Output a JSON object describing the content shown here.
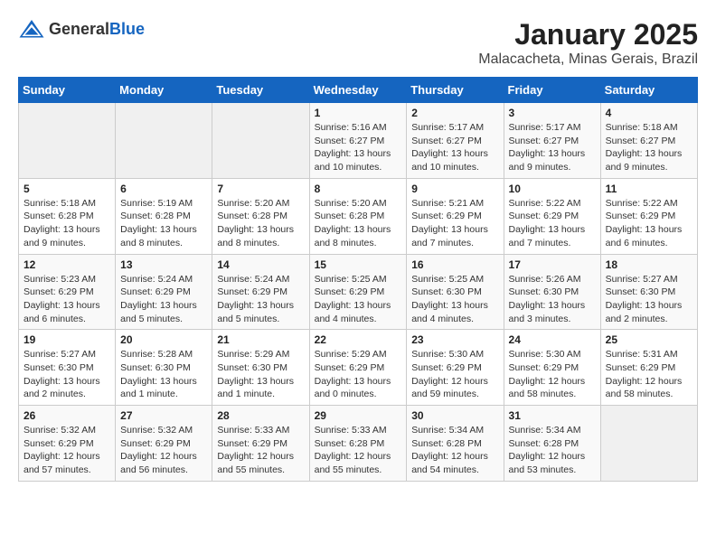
{
  "header": {
    "logo_general": "General",
    "logo_blue": "Blue",
    "title": "January 2025",
    "subtitle": "Malacacheta, Minas Gerais, Brazil"
  },
  "weekdays": [
    "Sunday",
    "Monday",
    "Tuesday",
    "Wednesday",
    "Thursday",
    "Friday",
    "Saturday"
  ],
  "weeks": [
    [
      {
        "day": "",
        "info": ""
      },
      {
        "day": "",
        "info": ""
      },
      {
        "day": "",
        "info": ""
      },
      {
        "day": "1",
        "info": "Sunrise: 5:16 AM\nSunset: 6:27 PM\nDaylight: 13 hours\nand 10 minutes."
      },
      {
        "day": "2",
        "info": "Sunrise: 5:17 AM\nSunset: 6:27 PM\nDaylight: 13 hours\nand 10 minutes."
      },
      {
        "day": "3",
        "info": "Sunrise: 5:17 AM\nSunset: 6:27 PM\nDaylight: 13 hours\nand 9 minutes."
      },
      {
        "day": "4",
        "info": "Sunrise: 5:18 AM\nSunset: 6:27 PM\nDaylight: 13 hours\nand 9 minutes."
      }
    ],
    [
      {
        "day": "5",
        "info": "Sunrise: 5:18 AM\nSunset: 6:28 PM\nDaylight: 13 hours\nand 9 minutes."
      },
      {
        "day": "6",
        "info": "Sunrise: 5:19 AM\nSunset: 6:28 PM\nDaylight: 13 hours\nand 8 minutes."
      },
      {
        "day": "7",
        "info": "Sunrise: 5:20 AM\nSunset: 6:28 PM\nDaylight: 13 hours\nand 8 minutes."
      },
      {
        "day": "8",
        "info": "Sunrise: 5:20 AM\nSunset: 6:28 PM\nDaylight: 13 hours\nand 8 minutes."
      },
      {
        "day": "9",
        "info": "Sunrise: 5:21 AM\nSunset: 6:29 PM\nDaylight: 13 hours\nand 7 minutes."
      },
      {
        "day": "10",
        "info": "Sunrise: 5:22 AM\nSunset: 6:29 PM\nDaylight: 13 hours\nand 7 minutes."
      },
      {
        "day": "11",
        "info": "Sunrise: 5:22 AM\nSunset: 6:29 PM\nDaylight: 13 hours\nand 6 minutes."
      }
    ],
    [
      {
        "day": "12",
        "info": "Sunrise: 5:23 AM\nSunset: 6:29 PM\nDaylight: 13 hours\nand 6 minutes."
      },
      {
        "day": "13",
        "info": "Sunrise: 5:24 AM\nSunset: 6:29 PM\nDaylight: 13 hours\nand 5 minutes."
      },
      {
        "day": "14",
        "info": "Sunrise: 5:24 AM\nSunset: 6:29 PM\nDaylight: 13 hours\nand 5 minutes."
      },
      {
        "day": "15",
        "info": "Sunrise: 5:25 AM\nSunset: 6:29 PM\nDaylight: 13 hours\nand 4 minutes."
      },
      {
        "day": "16",
        "info": "Sunrise: 5:25 AM\nSunset: 6:30 PM\nDaylight: 13 hours\nand 4 minutes."
      },
      {
        "day": "17",
        "info": "Sunrise: 5:26 AM\nSunset: 6:30 PM\nDaylight: 13 hours\nand 3 minutes."
      },
      {
        "day": "18",
        "info": "Sunrise: 5:27 AM\nSunset: 6:30 PM\nDaylight: 13 hours\nand 2 minutes."
      }
    ],
    [
      {
        "day": "19",
        "info": "Sunrise: 5:27 AM\nSunset: 6:30 PM\nDaylight: 13 hours\nand 2 minutes."
      },
      {
        "day": "20",
        "info": "Sunrise: 5:28 AM\nSunset: 6:30 PM\nDaylight: 13 hours\nand 1 minute."
      },
      {
        "day": "21",
        "info": "Sunrise: 5:29 AM\nSunset: 6:30 PM\nDaylight: 13 hours\nand 1 minute."
      },
      {
        "day": "22",
        "info": "Sunrise: 5:29 AM\nSunset: 6:29 PM\nDaylight: 13 hours\nand 0 minutes."
      },
      {
        "day": "23",
        "info": "Sunrise: 5:30 AM\nSunset: 6:29 PM\nDaylight: 12 hours\nand 59 minutes."
      },
      {
        "day": "24",
        "info": "Sunrise: 5:30 AM\nSunset: 6:29 PM\nDaylight: 12 hours\nand 58 minutes."
      },
      {
        "day": "25",
        "info": "Sunrise: 5:31 AM\nSunset: 6:29 PM\nDaylight: 12 hours\nand 58 minutes."
      }
    ],
    [
      {
        "day": "26",
        "info": "Sunrise: 5:32 AM\nSunset: 6:29 PM\nDaylight: 12 hours\nand 57 minutes."
      },
      {
        "day": "27",
        "info": "Sunrise: 5:32 AM\nSunset: 6:29 PM\nDaylight: 12 hours\nand 56 minutes."
      },
      {
        "day": "28",
        "info": "Sunrise: 5:33 AM\nSunset: 6:29 PM\nDaylight: 12 hours\nand 55 minutes."
      },
      {
        "day": "29",
        "info": "Sunrise: 5:33 AM\nSunset: 6:28 PM\nDaylight: 12 hours\nand 55 minutes."
      },
      {
        "day": "30",
        "info": "Sunrise: 5:34 AM\nSunset: 6:28 PM\nDaylight: 12 hours\nand 54 minutes."
      },
      {
        "day": "31",
        "info": "Sunrise: 5:34 AM\nSunset: 6:28 PM\nDaylight: 12 hours\nand 53 minutes."
      },
      {
        "day": "",
        "info": ""
      }
    ]
  ]
}
